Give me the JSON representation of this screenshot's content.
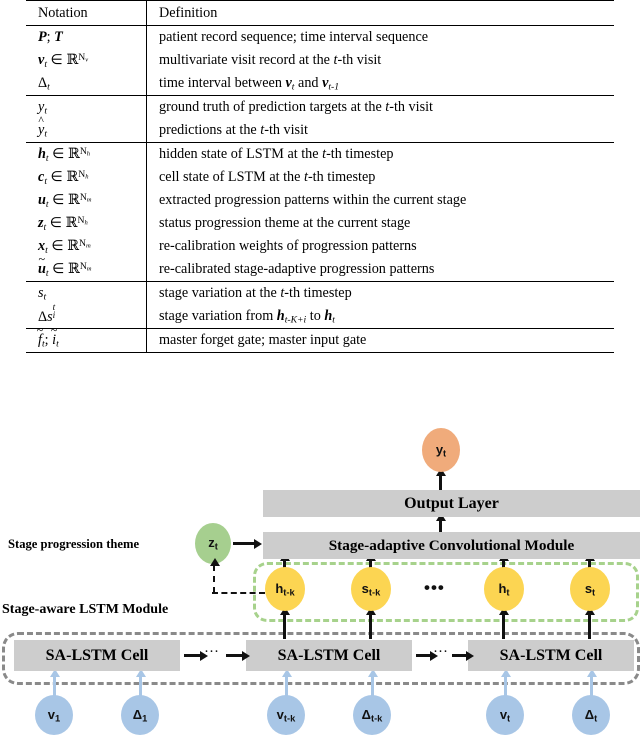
{
  "table": {
    "headers": [
      "Notation",
      "Definition"
    ],
    "groups": [
      {
        "rows": [
          {
            "notation_html": "<b class=\"bi\">P</b><span class=\"up\">;</span> <b class=\"bi\">T</b>",
            "notation_text": "P; T",
            "definition": "patient record sequence; time interval sequence"
          },
          {
            "notation_html": "<b class=\"bi\">v</b><sub>t</sub> <span class=\"up\">∈</span> <span class=\"bb\">ℝ</span><sup><span class=\"up\">N</span><sub style=\"vertical-align:-0.2em\">v</sub></sup>",
            "notation_text": "v_t ∈ R^{N_v}",
            "definition": "multivariate visit record at the t-th visit"
          },
          {
            "notation_html": "<span class=\"up\">Δ</span><sub>t</sub>",
            "notation_text": "Δ_t",
            "definition": "time interval between v_t and v_{t-1}"
          }
        ]
      },
      {
        "rows": [
          {
            "notation_html": "<span class=\"mi\">y</span><sub>t</sub>",
            "notation_text": "y_t",
            "definition": "ground truth of prediction targets at the t-th visit"
          },
          {
            "notation_html": "<span class=\"hat-wrap\"><span class=\"mi\">y</span></span><sub>t</sub>",
            "notation_text": "ŷ_t",
            "definition": "predictions at the t-th visit"
          }
        ]
      },
      {
        "rows": [
          {
            "notation_html": "<b class=\"bi\">h</b><sub>t</sub> <span class=\"up\">∈</span> <span class=\"bb\">ℝ</span><sup><span class=\"up\">N</span><sub style=\"vertical-align:-0.2em\">h</sub></sup>",
            "notation_text": "h_t ∈ R^{N_h}",
            "definition": "hidden state of LSTM at the t-th timestep"
          },
          {
            "notation_html": "<b class=\"bi\">c</b><sub>t</sub> <span class=\"up\">∈</span> <span class=\"bb\">ℝ</span><sup><span class=\"up\">N</span><sub style=\"vertical-align:-0.2em\">h</sub></sup>",
            "notation_text": "c_t ∈ R^{N_h}",
            "definition": "cell state of LSTM at the t-th timestep"
          },
          {
            "notation_html": "<b class=\"bi\">u</b><sub>t</sub> <span class=\"up\">∈</span> <span class=\"bb\">ℝ</span><sup><span class=\"up\">N</span><sub style=\"vertical-align:-0.2em\">m</sub></sup>",
            "notation_text": "u_t ∈ R^{N_m}",
            "definition": "extracted progression patterns within the current stage"
          },
          {
            "notation_html": "<b class=\"bi\">z</b><sub>t</sub> <span class=\"up\">∈</span> <span class=\"bb\">ℝ</span><sup><span class=\"up\">N</span><sub style=\"vertical-align:-0.2em\">h</sub></sup>",
            "notation_text": "z_t ∈ R^{N_h}",
            "definition": "status progression theme at the current stage"
          },
          {
            "notation_html": "<b class=\"bi\">x</b><sub>t</sub> <span class=\"up\">∈</span> <span class=\"bb\">ℝ</span><sup><span class=\"up\">N</span><sub style=\"vertical-align:-0.2em\">m</sub></sup>",
            "notation_text": "x_t ∈ R^{N_m}",
            "definition": "re-calibration weights of progression patterns"
          },
          {
            "notation_html": "<span class=\"tilde-wrap\"><b class=\"bi\">u</b></span><sub>t</sub> <span class=\"up\">∈</span> <span class=\"bb\">ℝ</span><sup><span class=\"up\">N</span><sub style=\"vertical-align:-0.2em\">m</sub></sup>",
            "notation_text": "ũ_t ∈ R^{N_m}",
            "definition": "re-calibrated stage-adaptive progression patterns"
          }
        ]
      },
      {
        "rows": [
          {
            "notation_html": "<span class=\"mi\">s</span><sub>t</sub>",
            "notation_text": "s_t",
            "definition": "stage variation at the t-th timestep"
          },
          {
            "notation_html": "<span class=\"up\">Δ</span><span class=\"mi\">s</span><span class=\"subsup\"><span class=\"s-sup\">t</span><span class=\"s-sub\">i</span></span>",
            "notation_text": "Δs_i^t",
            "definition": "stage variation from h_{t-K+i} to h_t"
          }
        ]
      },
      {
        "rows": [
          {
            "notation_html": "<span class=\"tilde-wrap\"><span class=\"mi\">f</span></span><sub>t</sub><span class=\"up\">;</span> <span class=\"tilde-wrap\"><span class=\"mi\">i</span></span><sub>t</sub>",
            "notation_text": "f̃_t; ĩ_t",
            "definition": "master forget gate; master input gate"
          }
        ]
      }
    ]
  },
  "diagram": {
    "labels": {
      "stage_progression_theme": "Stage progression theme",
      "stage_aware_lstm_module": "Stage-aware LSTM Module",
      "output_layer": "Output Layer",
      "sac_module": "Stage-adaptive Convolutional Module"
    },
    "nodes": {
      "output": {
        "base": "y",
        "sub": "t"
      },
      "theme": {
        "base": "z",
        "sub": "t"
      },
      "hidden_states": [
        {
          "base": "h",
          "sub": "t-k"
        },
        {
          "base": "s",
          "sub": "t-k"
        },
        {
          "base": "h",
          "sub": "t"
        },
        {
          "base": "s",
          "sub": "t"
        }
      ],
      "inputs": [
        {
          "base": "v",
          "sub": "1"
        },
        {
          "base": "Δ",
          "sub": "1"
        },
        {
          "base": "v",
          "sub": "t-k"
        },
        {
          "base": "Δ",
          "sub": "t-k"
        },
        {
          "base": "v",
          "sub": "t"
        },
        {
          "base": "Δ",
          "sub": "t"
        }
      ]
    },
    "cells": [
      "SA-LSTM Cell",
      "SA-LSTM Cell",
      "SA-LSTM Cell"
    ],
    "ellipses": {
      "between_states": "•••",
      "between_cells": "···"
    },
    "colors": {
      "output_node": "#f0ab7b",
      "theme_node": "#a6cf8f",
      "state_node": "#fcd552",
      "input_node": "#a8c6e6",
      "gray_box": "#cdcdcd",
      "green_dash": "#a7d28c",
      "gray_dash": "#8a8a8a"
    }
  }
}
